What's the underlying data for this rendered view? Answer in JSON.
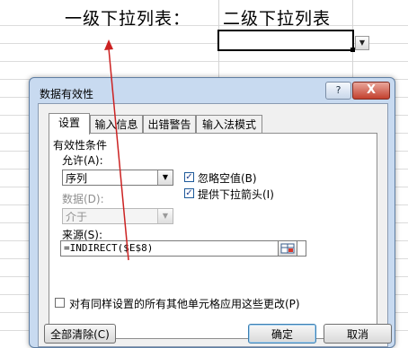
{
  "sheet": {
    "label_level1": "一级下拉列表：",
    "label_level2": "二级下拉列表"
  },
  "dialog": {
    "title": "数据有效性",
    "help": "?",
    "close": "X",
    "tabs": [
      {
        "label": "设置",
        "active": true
      },
      {
        "label": "输入信息",
        "active": false
      },
      {
        "label": "出错警告",
        "active": false
      },
      {
        "label": "输入法模式",
        "active": false
      }
    ],
    "criteria_group": "有效性条件",
    "allow_label": "允许(A):",
    "allow_value": "序列",
    "data_label": "数据(D):",
    "data_value": "介于",
    "ignore_blank": {
      "label": "忽略空值(B)",
      "checked": true
    },
    "in_cell_dropdown": {
      "label": "提供下拉箭头(I)",
      "checked": true
    },
    "source_label": "来源(S):",
    "source_value": "=INDIRECT($E$8)",
    "apply_all": {
      "label": "对有同样设置的所有其他单元格应用这些更改(P)",
      "checked": false
    },
    "clear_all": "全部清除(C)",
    "ok": "确定",
    "cancel": "取消"
  },
  "colors": {
    "arrow": "#cc2222",
    "dialog_frame": "#c8daf0"
  },
  "icons": {
    "dropdown": "chevron-down-icon",
    "range": "range-select-icon",
    "help": "help-icon",
    "close": "close-icon"
  }
}
